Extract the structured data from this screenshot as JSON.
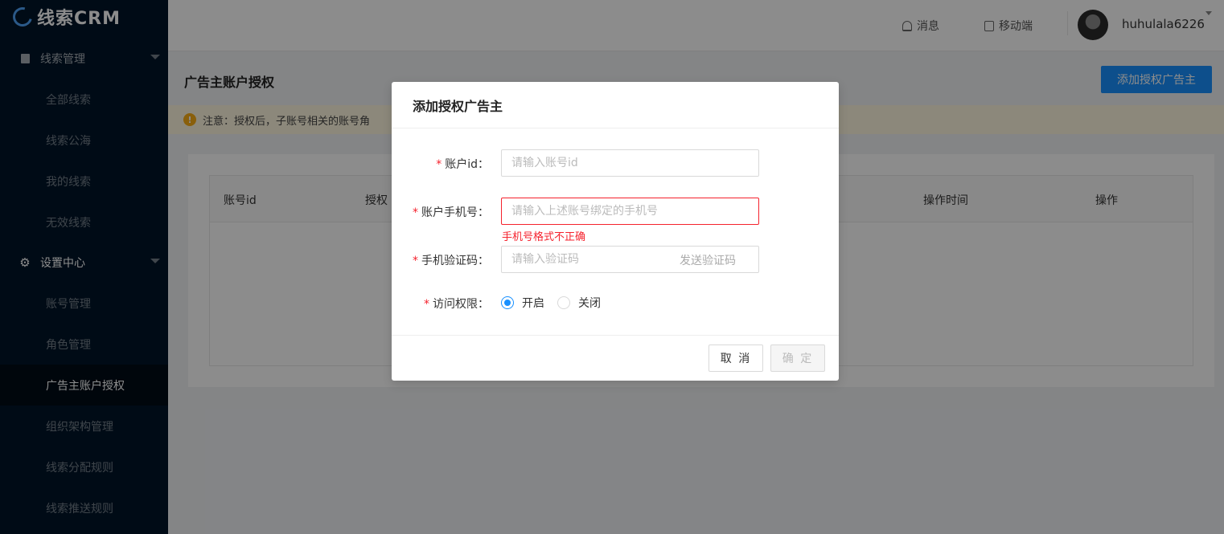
{
  "app": {
    "logo_text": "线索CRM"
  },
  "sidebar": {
    "group1": {
      "label": "线索管理"
    },
    "group1_items": [
      {
        "label": "全部线索"
      },
      {
        "label": "线索公海"
      },
      {
        "label": "我的线索"
      },
      {
        "label": "无效线索"
      }
    ],
    "group2": {
      "label": "设置中心"
    },
    "group2_items": [
      {
        "label": "账号管理"
      },
      {
        "label": "角色管理"
      },
      {
        "label": "广告主账户授权"
      },
      {
        "label": "组织架构管理"
      },
      {
        "label": "线索分配规则"
      },
      {
        "label": "线索推送规则"
      }
    ]
  },
  "header": {
    "messages_label": "消息",
    "mobile_label": "移动端",
    "username": "huhulala6226"
  },
  "page": {
    "title": "广告主账户授权",
    "add_button_label": "添加授权广告主",
    "notice_text": "注意：授权后，子账号相关的账号角",
    "table": {
      "columns": [
        "账号id",
        "授权",
        "操作时间",
        "操作"
      ]
    }
  },
  "modal": {
    "title": "添加授权广告主",
    "account_id": {
      "label": "账户id：",
      "placeholder": "请输入账号id",
      "value": ""
    },
    "phone": {
      "label": "账户手机号：",
      "placeholder": "请输入上述账号绑定的手机号",
      "value": "",
      "error": "手机号格式不正确"
    },
    "code": {
      "label": "手机验证码：",
      "placeholder": "请输入验证码",
      "value": "",
      "send_label": "发送验证码"
    },
    "access": {
      "label": "访问权限：",
      "options": [
        "开启",
        "关闭"
      ],
      "selected": "开启"
    },
    "cancel_label": "取 消",
    "ok_label": "确 定"
  }
}
